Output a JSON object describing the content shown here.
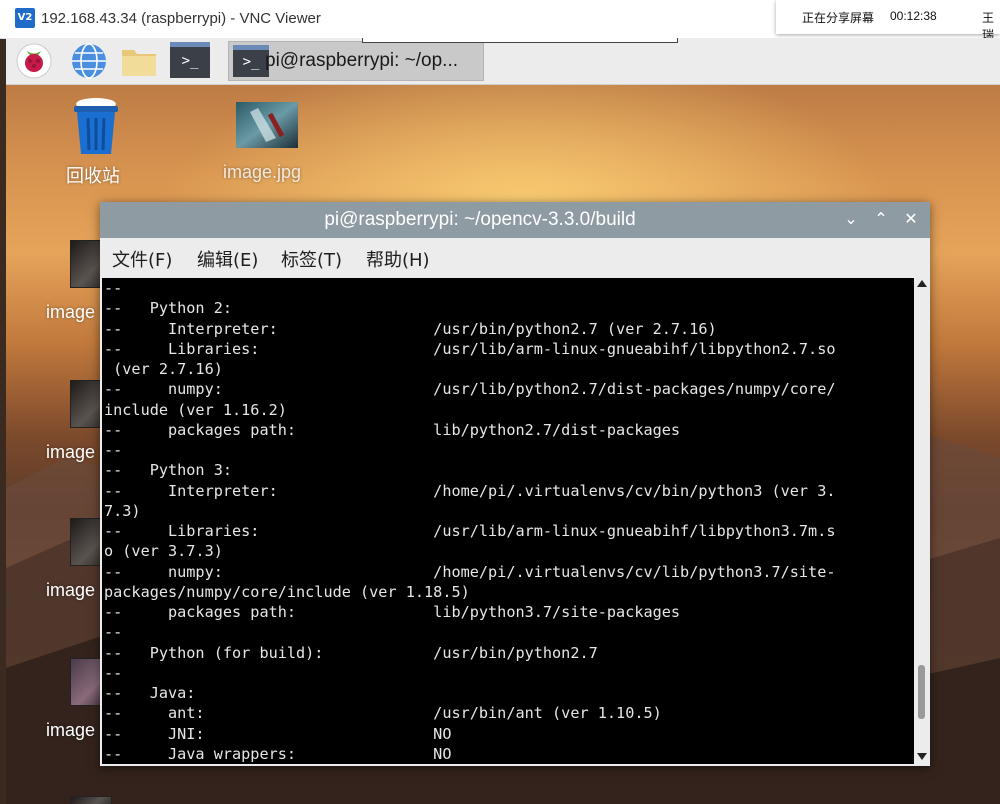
{
  "vnc": {
    "logo": "V2",
    "title": "192.168.43.34 (raspberrypi) - VNC Viewer"
  },
  "share": {
    "label": "正在分享屏幕",
    "timer": "00:12:38",
    "user": "王瑞"
  },
  "taskbar": {
    "icons": [
      "raspberry-menu-icon",
      "web-browser-icon",
      "file-manager-icon",
      "terminal-launcher-icon"
    ],
    "task_label": "pi@raspberrypi: ~/op..."
  },
  "desktop": {
    "icons": [
      {
        "name": "trash-icon",
        "label": "回收站"
      },
      {
        "name": "image-file-icon",
        "label": "image.jpg"
      }
    ],
    "side_label": "image"
  },
  "terminal": {
    "title": "pi@raspberrypi: ~/opencv-3.3.0/build",
    "menu": [
      "文件(F)",
      "编辑(E)",
      "标签(T)",
      "帮助(H)"
    ],
    "lines": [
      "--",
      "--   Python 2:",
      "--     Interpreter:                 /usr/bin/python2.7 (ver 2.7.16)",
      "--     Libraries:                   /usr/lib/arm-linux-gnueabihf/libpython2.7.so",
      " (ver 2.7.16)",
      "--     numpy:                       /usr/lib/python2.7/dist-packages/numpy/core/",
      "include (ver 1.16.2)",
      "--     packages path:               lib/python2.7/dist-packages",
      "--",
      "--   Python 3:",
      "--     Interpreter:                 /home/pi/.virtualenvs/cv/bin/python3 (ver 3.",
      "7.3)",
      "--     Libraries:                   /usr/lib/arm-linux-gnueabihf/libpython3.7m.s",
      "o (ver 3.7.3)",
      "--     numpy:                       /home/pi/.virtualenvs/cv/lib/python3.7/site-",
      "packages/numpy/core/include (ver 1.18.5)",
      "--     packages path:               lib/python3.7/site-packages",
      "--",
      "--   Python (for build):            /usr/bin/python2.7",
      "--",
      "--   Java:",
      "--     ant:                         /usr/bin/ant (ver 1.10.5)",
      "--     JNI:                         NO",
      "--     Java wrappers:               NO"
    ],
    "scroll_position": 0.92
  }
}
